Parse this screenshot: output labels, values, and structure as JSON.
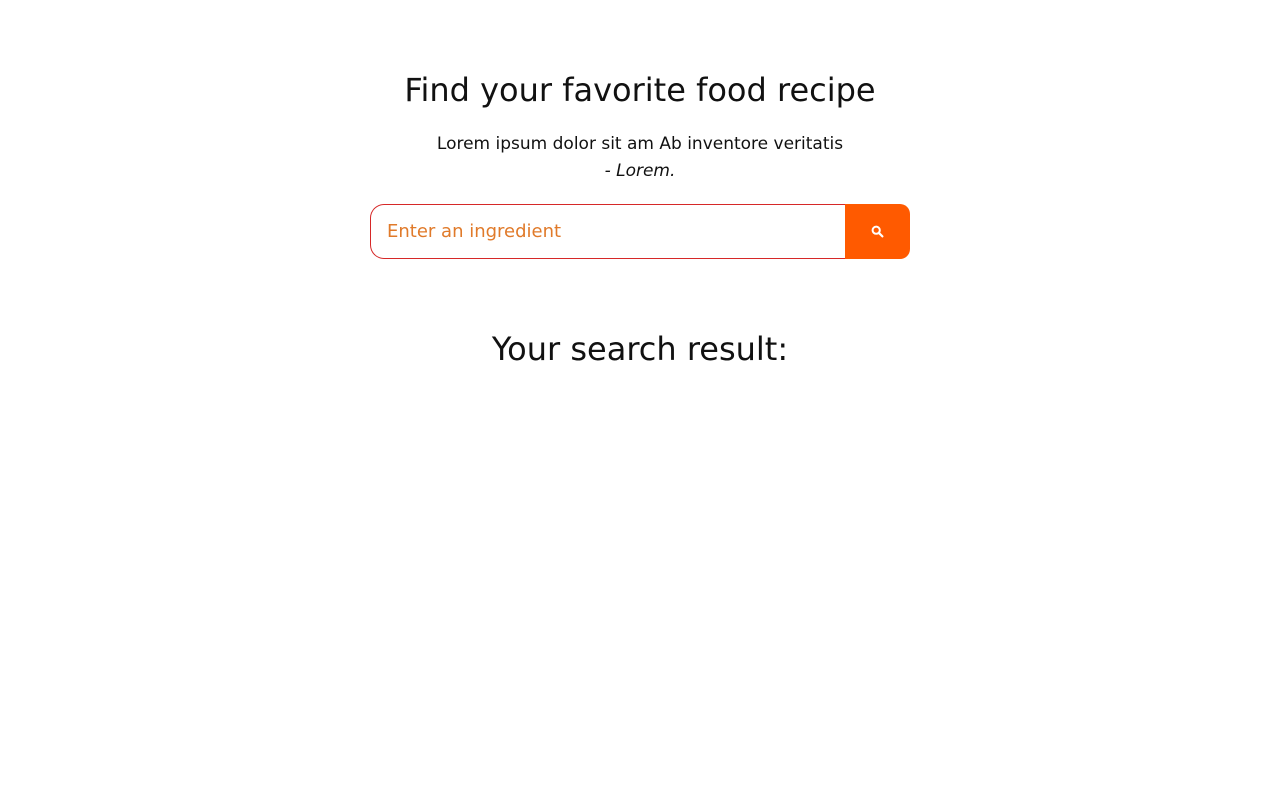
{
  "hero": {
    "title": "Find your favorite food recipe",
    "quote": "Lorem ipsum dolor sit am Ab inventore veritatis",
    "quote_author": "- Lorem."
  },
  "search": {
    "placeholder": "Enter an ingredient",
    "value": "",
    "button_icon": "search-icon"
  },
  "results": {
    "title": "Your search result:",
    "items": []
  },
  "colors": {
    "accent": "#ff5a00",
    "input_border": "#d62828",
    "placeholder": "#e07a2a"
  }
}
